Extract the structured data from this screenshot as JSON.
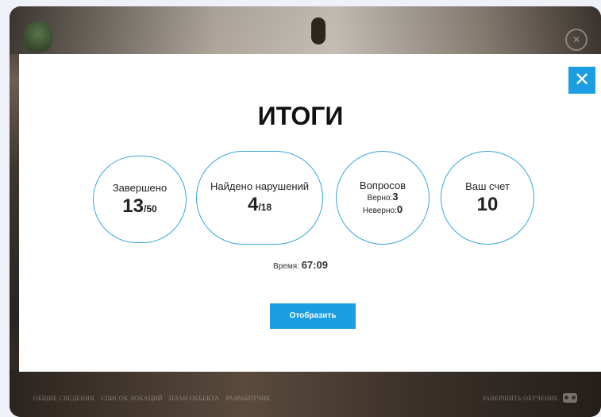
{
  "background": {
    "bottom_menu": [
      "ОБЩИЕ СВЕДЕНИЯ",
      "СПИСОК ЛОКАЦИЙ",
      "ПЛАН ОБЪЕКТА",
      "РАЗРАБОТЧИК"
    ],
    "finish_label": "ЗАВЕРШИТЬ ОБУЧЕНИЕ",
    "close_glyph": "×"
  },
  "modal": {
    "close_glyph": "✕",
    "title": "ИТОГИ",
    "stats": {
      "completed": {
        "label": "Завершено",
        "value": "13",
        "total": "/50"
      },
      "violations": {
        "label": "Найдено нарушений",
        "value": "4",
        "total": "/18"
      },
      "questions": {
        "label": "Вопросов",
        "correct_label": "Верно:",
        "correct": "3",
        "wrong_label": "Неверно:",
        "wrong": "0"
      },
      "score": {
        "label": "Ваш счет",
        "value": "10"
      }
    },
    "time_label": "Время:",
    "time_value": "67:09",
    "show_button": "Отобразить"
  },
  "colors": {
    "accent": "#1b9ee2",
    "circle_border": "#3aa5de"
  }
}
